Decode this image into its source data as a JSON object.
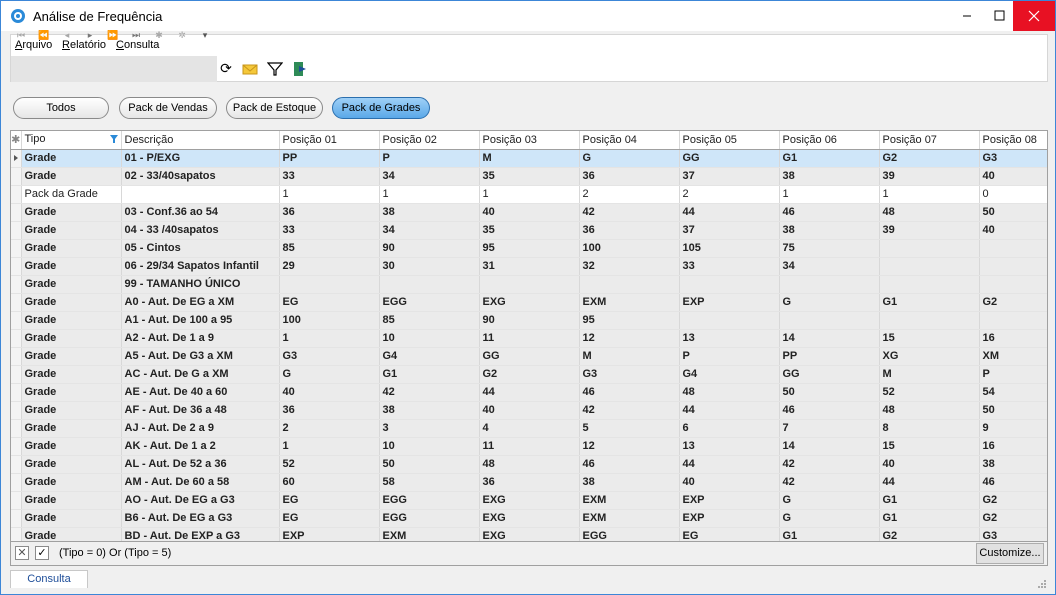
{
  "window": {
    "title": "Análise de Frequência"
  },
  "menu": {
    "items": [
      {
        "first": "A",
        "rest": "rquivo"
      },
      {
        "first": "R",
        "rest": "elatório"
      },
      {
        "first": "C",
        "rest": "onsulta"
      }
    ]
  },
  "toolbar": {
    "icons": [
      "first-record-icon",
      "prev-page-icon",
      "prev-record-icon",
      "next-record-icon",
      "next-page-icon",
      "last-record-icon",
      "insert-icon",
      "delete-icon",
      "filter-row-icon",
      "refresh-icon",
      "email-icon",
      "filter-icon",
      "exit-icon"
    ]
  },
  "filters": {
    "buttons": [
      "Todos",
      "Pack de Vendas",
      "Pack de Estoque",
      "Pack de Grades"
    ],
    "active": "Pack de Grades"
  },
  "grid": {
    "columns": [
      "Tipo",
      "Descrição",
      "Posição 01",
      "Posição 02",
      "Posição 03",
      "Posição 04",
      "Posição 05",
      "Posição 06",
      "Posição 07",
      "Posição 08"
    ],
    "rows": [
      {
        "kind": "sel",
        "cells": [
          "Grade",
          "01 - P/EXG",
          "PP",
          "P",
          "M",
          "G",
          "GG",
          "G1",
          "G2",
          "G3"
        ]
      },
      {
        "kind": "alt",
        "cells": [
          "Grade",
          "02 - 33/40sapatos",
          "33",
          "34",
          "35",
          "36",
          "37",
          "38",
          "39",
          "40"
        ]
      },
      {
        "kind": "pack",
        "cells": [
          "Pack da Grade",
          "",
          "1",
          "1",
          "1",
          "2",
          "2",
          "1",
          "1",
          "0"
        ]
      },
      {
        "kind": "alt",
        "cells": [
          "Grade",
          "03 - Conf.36 ao 54",
          "36",
          "38",
          "40",
          "42",
          "44",
          "46",
          "48",
          "50"
        ]
      },
      {
        "kind": "alt",
        "cells": [
          "Grade",
          "04 - 33 /40sapatos",
          "33",
          "34",
          "35",
          "36",
          "37",
          "38",
          "39",
          "40"
        ]
      },
      {
        "kind": "alt",
        "cells": [
          "Grade",
          "05 - Cintos",
          "85",
          "90",
          "95",
          "100",
          "105",
          "75",
          "",
          ""
        ]
      },
      {
        "kind": "alt",
        "cells": [
          "Grade",
          "06 - 29/34 Sapatos Infantil",
          "29",
          "30",
          "31",
          "32",
          "33",
          "34",
          "",
          ""
        ]
      },
      {
        "kind": "alt",
        "cells": [
          "Grade",
          "99 - TAMANHO ÚNICO",
          "",
          "",
          "",
          "",
          "",
          "",
          "",
          ""
        ]
      },
      {
        "kind": "alt",
        "cells": [
          "Grade",
          "A0 - Aut. De EG a XM",
          "EG",
          "EGG",
          "EXG",
          "EXM",
          "EXP",
          "G",
          "G1",
          "G2"
        ]
      },
      {
        "kind": "alt",
        "cells": [
          "Grade",
          "A1 - Aut. De 100 a 95",
          "100",
          "85",
          "90",
          "95",
          "",
          "",
          "",
          ""
        ]
      },
      {
        "kind": "alt",
        "cells": [
          "Grade",
          "A2 - Aut. De 1 a 9",
          "1",
          "10",
          "11",
          "12",
          "13",
          "14",
          "15",
          "16"
        ]
      },
      {
        "kind": "alt",
        "cells": [
          "Grade",
          "A5 - Aut. De G3 a XM",
          "G3",
          "G4",
          "GG",
          "M",
          "P",
          "PP",
          "XG",
          "XM"
        ]
      },
      {
        "kind": "alt",
        "cells": [
          "Grade",
          "AC - Aut. De G a XM",
          "G",
          "G1",
          "G2",
          "G3",
          "G4",
          "GG",
          "M",
          "P"
        ]
      },
      {
        "kind": "alt",
        "cells": [
          "Grade",
          "AE - Aut. De 40 a 60",
          "40",
          "42",
          "44",
          "46",
          "48",
          "50",
          "52",
          "54"
        ]
      },
      {
        "kind": "alt",
        "cells": [
          "Grade",
          "AF - Aut. De 36 a 48",
          "36",
          "38",
          "40",
          "42",
          "44",
          "46",
          "48",
          "50"
        ]
      },
      {
        "kind": "alt",
        "cells": [
          "Grade",
          "AJ - Aut. De 2 a 9",
          "2",
          "3",
          "4",
          "5",
          "6",
          "7",
          "8",
          "9"
        ]
      },
      {
        "kind": "alt",
        "cells": [
          "Grade",
          "AK - Aut. De 1 a 2",
          "1",
          "10",
          "11",
          "12",
          "13",
          "14",
          "15",
          "16"
        ]
      },
      {
        "kind": "alt",
        "cells": [
          "Grade",
          "AL - Aut. De 52 a 36",
          "52",
          "50",
          "48",
          "46",
          "44",
          "42",
          "40",
          "38"
        ]
      },
      {
        "kind": "alt",
        "cells": [
          "Grade",
          "AM - Aut. De 60 a 58",
          "60",
          "58",
          "36",
          "38",
          "40",
          "42",
          "44",
          "46"
        ]
      },
      {
        "kind": "alt",
        "cells": [
          "Grade",
          "AO - Aut. De EG a G3",
          "EG",
          "EGG",
          "EXG",
          "EXM",
          "EXP",
          "G",
          "G1",
          "G2"
        ]
      },
      {
        "kind": "alt",
        "cells": [
          "Grade",
          "B6 - Aut. De EG a G3",
          "EG",
          "EGG",
          "EXG",
          "EXM",
          "EXP",
          "G",
          "G1",
          "G2"
        ]
      },
      {
        "kind": "alt",
        "cells": [
          "Grade",
          "BD - Aut. De EXP a G3",
          "EXP",
          "EXM",
          "EXG",
          "EGG",
          "EG",
          "G1",
          "G2",
          "G3"
        ]
      }
    ]
  },
  "filter_bar": {
    "expression": "(Tipo = 0) Or (Tipo = 5)",
    "customize_label": "Customize..."
  },
  "tabs": {
    "active": "Consulta"
  },
  "colors": {
    "accent": "#3c86d7",
    "selected_row": "#cfe6f9",
    "close_button": "#e81123"
  }
}
